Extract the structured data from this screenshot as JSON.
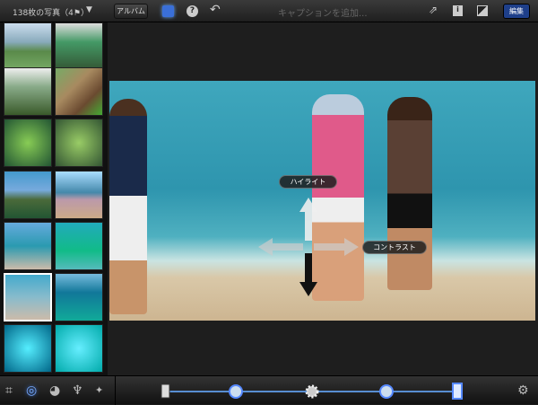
{
  "topbar": {
    "photo_count": "138枚の写真（4⚑）",
    "album_button": "アルバム",
    "caption_placeholder": "キャプションを追加...",
    "edit_button": "編集",
    "accent": "#3a6fd8"
  },
  "overlay": {
    "highlight_label": "ハイライト",
    "contrast_label": "コントラスト"
  },
  "toolbar": {
    "tools": [
      "crop-icon",
      "exposure-icon",
      "color-icon",
      "brushes-icon",
      "effects-icon"
    ],
    "active_tool": "exposure-icon",
    "settings": "gear-icon"
  },
  "exposure_slider": {
    "handles": [
      "black-point",
      "shadows",
      "brightness",
      "highlights",
      "white-point"
    ]
  },
  "sidebar": {
    "thumbnail_count": 14,
    "selected_index": 10
  }
}
